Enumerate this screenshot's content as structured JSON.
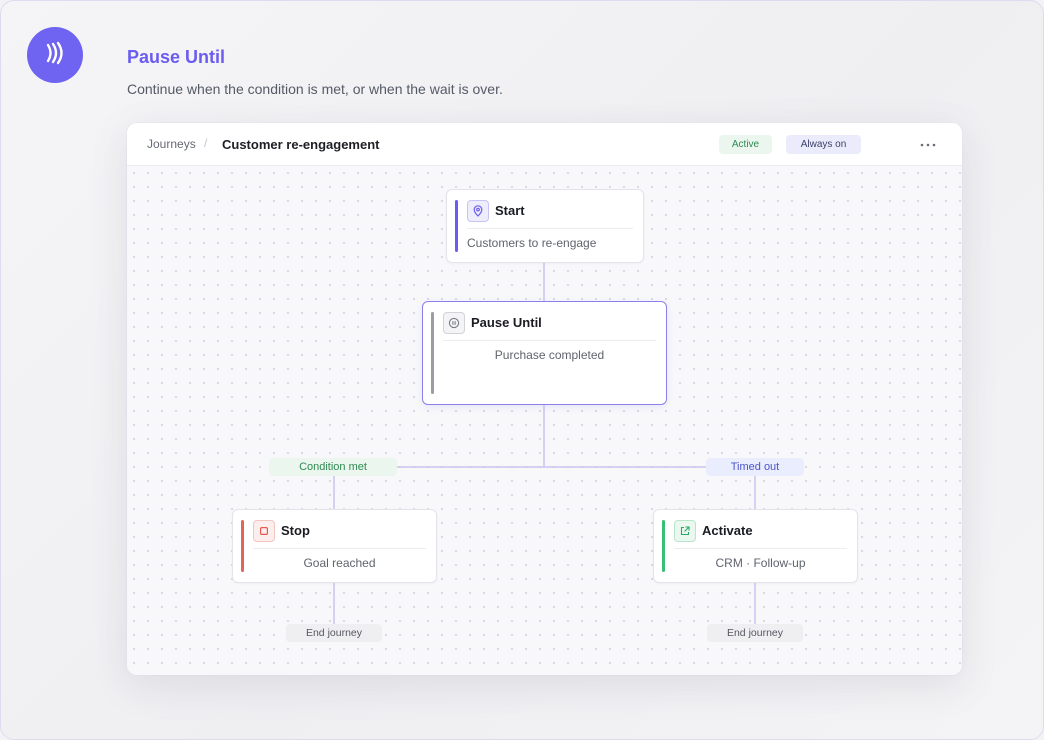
{
  "header": {
    "title": "Pause Until",
    "subtitle": "Continue when the condition is met, or when the wait is over."
  },
  "panel": {
    "breadcrumb": {
      "root": "Journeys",
      "separator": "/",
      "current": "Customer re-engagement"
    },
    "badges": {
      "status": "Active",
      "mode": "Always on"
    }
  },
  "flow": {
    "start": {
      "title": "Start",
      "description": "Customers to re-engage",
      "icon": "location-pin-icon"
    },
    "pause": {
      "title": "Pause Until",
      "description": "Purchase completed",
      "icon": "pause-icon"
    },
    "branch_condition": "Condition met",
    "branch_timeout": "Timed out",
    "stop": {
      "title": "Stop",
      "description": "Goal reached",
      "icon": "stop-icon"
    },
    "activate": {
      "title": "Activate",
      "description": "CRM · Follow-up",
      "icon": "external-link-icon"
    },
    "end_left": "End journey",
    "end_right": "End journey"
  },
  "colors": {
    "brand": "#6f63f1",
    "start_accent": "#6b5cf0",
    "pause_accent": "#9c9ca4",
    "stop_accent": "#e5645a",
    "activate_accent": "#35c073",
    "edge": "#c9c6ee"
  }
}
